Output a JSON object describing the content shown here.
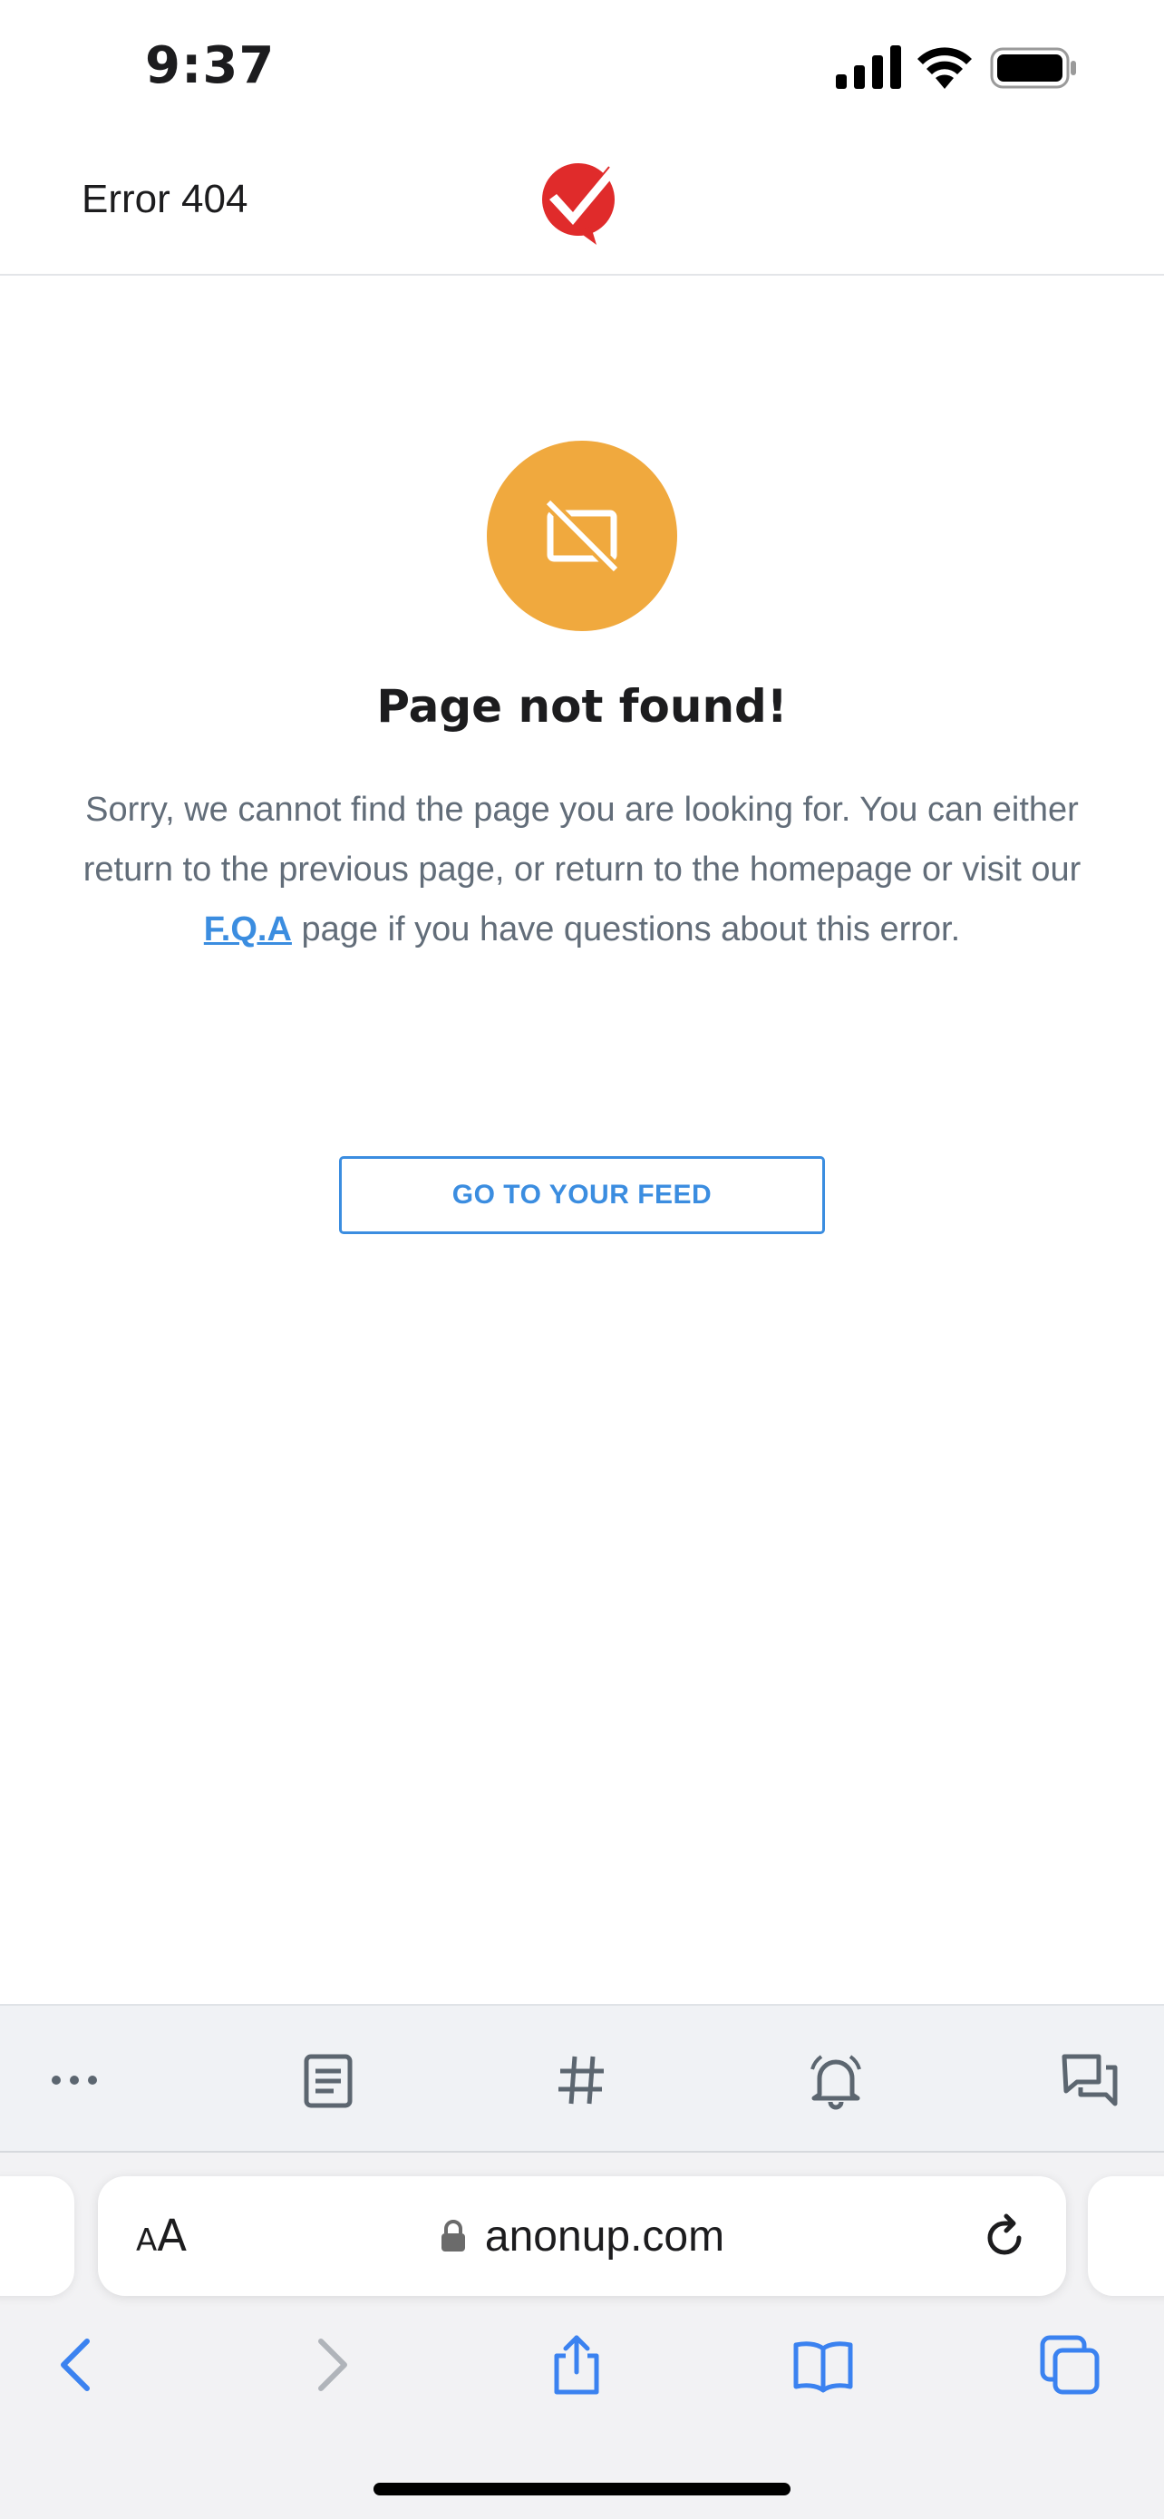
{
  "status_bar": {
    "time": "9:37"
  },
  "header": {
    "title": "Error 404",
    "logo_icon": "anonup-check-bubble-logo"
  },
  "error": {
    "icon": "image-off-icon",
    "title": "Page not found!",
    "message_part1": "Sorry, we cannot find the page you are looking for. You can either return to the previous page, or return to the homepage or visit our ",
    "faq_link": "F.Q.A",
    "message_part2": " page if you have questions about this error."
  },
  "actions": {
    "feed_button": "GO TO YOUR FEED"
  },
  "bottom_nav": {
    "items": [
      {
        "icon": "more-icon"
      },
      {
        "icon": "document-icon"
      },
      {
        "icon": "hashtag-icon"
      },
      {
        "icon": "bell-icon"
      },
      {
        "icon": "chat-icon"
      }
    ]
  },
  "browser": {
    "text_size_label": "AA",
    "url": "anonup.com",
    "toolbar": [
      "back-icon",
      "forward-icon",
      "share-icon",
      "bookmarks-icon",
      "tabs-icon"
    ]
  },
  "colors": {
    "accent": "#3b8de0",
    "icon_bg": "#f0a93e",
    "logo_red": "#e02b2b",
    "muted_text": "#626d79"
  }
}
